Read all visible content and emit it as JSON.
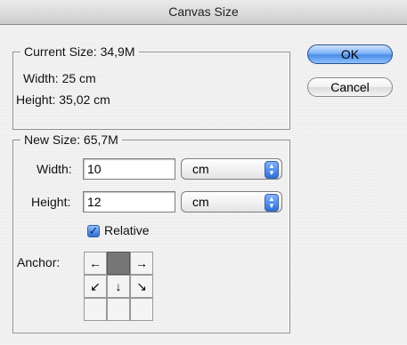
{
  "window": {
    "title": "Canvas Size"
  },
  "current_size": {
    "legend": "Current Size:  34,9M",
    "width_text": "Width:  25 cm",
    "height_text": "Height:  35,02 cm"
  },
  "new_size": {
    "legend": "New Size:  65,7M",
    "width_label": "Width:",
    "width_value": "10",
    "width_unit": "cm",
    "height_label": "Height:",
    "height_value": "12",
    "height_unit": "cm",
    "relative_label": "Relative",
    "relative_checked": true,
    "anchor_label": "Anchor:",
    "anchor_selected": "top-center",
    "anchor_arrows": [
      "←",
      "",
      "→",
      "↙",
      "↓",
      "↘",
      "",
      "",
      ""
    ]
  },
  "buttons": {
    "ok": "OK",
    "cancel": "Cancel"
  },
  "colors": {
    "default_button": "#4a8ee8",
    "checkbox": "#2b6ddc",
    "popup_arrows": "#2d6fe0"
  }
}
